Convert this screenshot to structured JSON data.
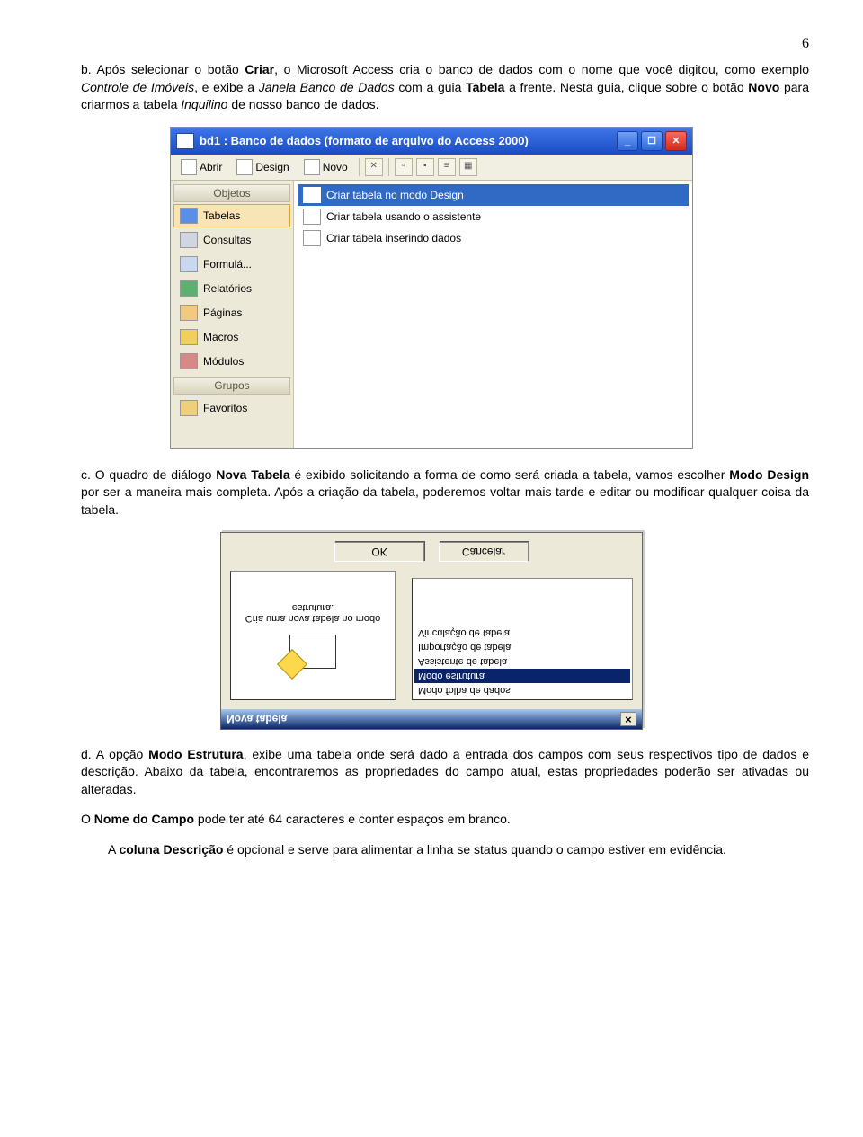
{
  "page_number": "6",
  "paragraphs": {
    "b_prefix": "b.",
    "b_before1": " Após selecionar o botão ",
    "b_bold1": "Criar",
    "b_after1": ", o Microsoft Access cria o banco de dados com o nome que você digitou, como exemplo ",
    "b_italic1": "Controle de Imóveis",
    "b_after2": ", e exibe a ",
    "b_italic2": "Janela Banco de Dados",
    "b_after3": " com a guia ",
    "b_bold2": "Tabela",
    "b_after4": " a frente. Nesta guia, clique sobre o botão ",
    "b_bold3": "Novo",
    "b_after5": " para criarmos a tabela ",
    "b_italic3": "Inquilino",
    "b_after6": " de nosso banco de dados.",
    "c_prefix": "c.",
    "c_before1": " O quadro de diálogo ",
    "c_bold1": "Nova Tabela",
    "c_after1": " é exibido solicitando a forma de como será criada a tabela, vamos escolher ",
    "c_bold2": "Modo Design",
    "c_after2": " por ser a maneira mais completa. Após a criação da tabela, poderemos voltar mais tarde e editar ou modificar qualquer coisa da tabela.",
    "d_prefix": "d.",
    "d_before1": " A opção ",
    "d_bold1": "Modo Estrutura",
    "d_after1": ", exibe uma tabela onde será dado a entrada dos campos com seus respectivos tipo de dados e descrição. Abaixo da tabela, encontraremos as propriedades do campo atual, estas propriedades poderão ser ativadas ou alteradas.",
    "d_line2a": "O ",
    "d_line2b": "Nome do Campo",
    "d_line2c": " pode ter até 64 caracteres e conter espaços em branco.",
    "d_line3a": "A ",
    "d_line3b": "coluna Descrição",
    "d_line3c": " é opcional e serve para alimentar a linha se status quando o campo estiver em evidência."
  },
  "dbwindow": {
    "title": "bd1 : Banco de dados (formato de arquivo do Access 2000)",
    "toolbar": {
      "abrir": "Abrir",
      "design": "Design",
      "novo": "Novo"
    },
    "side_header1": "Objetos",
    "side_items": [
      "Tabelas",
      "Consultas",
      "Formulá...",
      "Relatórios",
      "Páginas",
      "Macros",
      "Módulos"
    ],
    "side_header2": "Grupos",
    "side_fav": "Favoritos",
    "main_items": [
      "Criar tabela no modo Design",
      "Criar tabela usando o assistente",
      "Criar tabela inserindo dados"
    ],
    "side_icon_colors": [
      "#5b8fe6",
      "#9d9d9d",
      "#c27bcf",
      "#3da052",
      "#f2a13a",
      "#e0c24a",
      "#b65858"
    ]
  },
  "dialog": {
    "title": "Nova tabela",
    "desc": "Cria uma nova tabela no modo estrutura.",
    "options": [
      "Modo folha de dados",
      "Modo estrutura",
      "Assistente de tabela",
      "Importação de tabela",
      "Vinculação de tabela"
    ],
    "ok": "OK",
    "cancel": "Cancelar"
  }
}
